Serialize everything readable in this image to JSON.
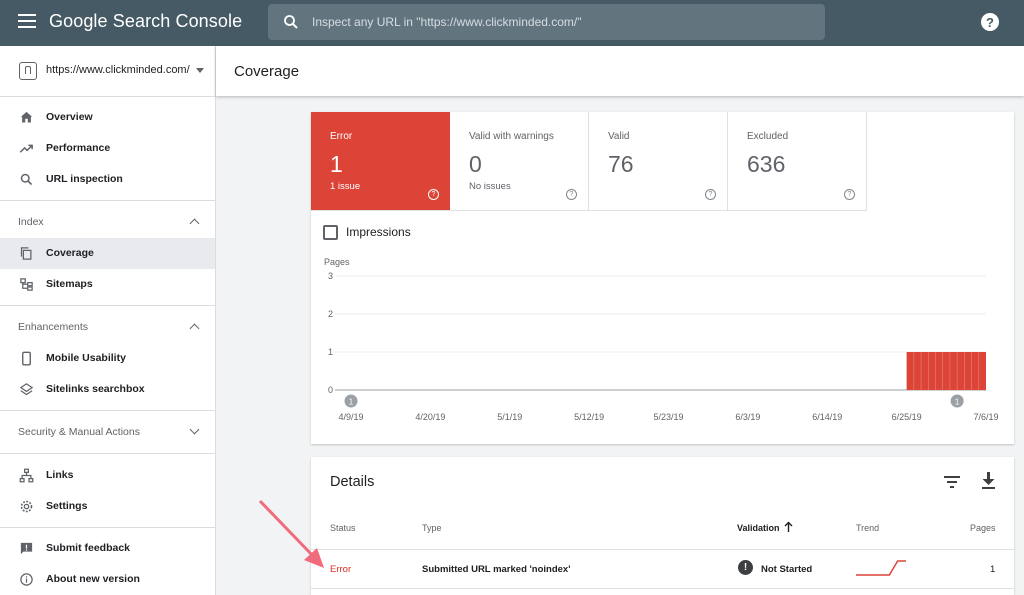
{
  "app": {
    "title": "Google Search Console",
    "search_placeholder": "Inspect any URL in \"https://www.clickminded.com/\"",
    "help_icon": "?"
  },
  "sidebar": {
    "property": "https://www.clickminded.com/",
    "items_top": [
      {
        "label": "Overview",
        "icon": "home-icon"
      },
      {
        "label": "Performance",
        "icon": "trending-up-icon"
      },
      {
        "label": "URL inspection",
        "icon": "search-icon"
      }
    ],
    "index": {
      "label": "Index",
      "items": [
        {
          "label": "Coverage",
          "icon": "copy-icon",
          "active": true
        },
        {
          "label": "Sitemaps",
          "icon": "sitemap-icon"
        }
      ]
    },
    "enhancements": {
      "label": "Enhancements",
      "items": [
        {
          "label": "Mobile Usability",
          "icon": "phone-icon"
        },
        {
          "label": "Sitelinks searchbox",
          "icon": "layers-icon"
        }
      ]
    },
    "security": {
      "label": "Security & Manual Actions"
    },
    "items_bottom": [
      {
        "label": "Links",
        "icon": "links-icon"
      },
      {
        "label": "Settings",
        "icon": "gear-icon"
      }
    ],
    "items_footer": [
      {
        "label": "Submit feedback",
        "icon": "feedback-icon"
      },
      {
        "label": "About new version",
        "icon": "info-icon"
      }
    ]
  },
  "page": {
    "title": "Coverage"
  },
  "coverage": {
    "tiles": [
      {
        "label": "Error",
        "value": "1",
        "sub": "1 issue",
        "status": "error",
        "color": "#db4437"
      },
      {
        "label": "Valid with warnings",
        "value": "0",
        "sub": "No issues",
        "status": "warning"
      },
      {
        "label": "Valid",
        "value": "76",
        "sub": "",
        "status": "valid"
      },
      {
        "label": "Excluded",
        "value": "636",
        "sub": "",
        "status": "excluded"
      }
    ],
    "impressions_label": "Impressions"
  },
  "chart_data": {
    "type": "bar",
    "ylabel": "Pages",
    "ylim": [
      0,
      3
    ],
    "yticks": [
      0,
      1,
      2,
      3
    ],
    "grid": true,
    "x_tick_labels": [
      "4/9/19",
      "4/20/19",
      "5/1/19",
      "5/12/19",
      "5/23/19",
      "6/3/19",
      "6/14/19",
      "6/25/19",
      "7/6/19"
    ],
    "x_start": "2019-04-09",
    "x_end": "2019-07-06",
    "series": [
      {
        "color": "#db4437",
        "segments": [
          {
            "from": "2019-06-25",
            "to": "2019-07-06",
            "value": 1
          }
        ]
      }
    ],
    "annotations": [
      {
        "date": "2019-04-09",
        "label": "1"
      },
      {
        "date": "2019-07-02",
        "label": "1"
      }
    ]
  },
  "details": {
    "title": "Details",
    "columns": {
      "status": "Status",
      "type": "Type",
      "validation": "Validation",
      "trend": "Trend",
      "pages": "Pages"
    },
    "rows": [
      {
        "status": "Error",
        "type": "Submitted URL marked 'noindex'",
        "validation": "Not Started",
        "validation_icon": "!",
        "pages": "1",
        "trend": [
          0,
          0,
          0,
          0,
          0,
          1,
          1
        ]
      }
    ]
  },
  "colors": {
    "topbar": "#455a64",
    "error": "#db4437",
    "arrow": "#f06b7b"
  }
}
